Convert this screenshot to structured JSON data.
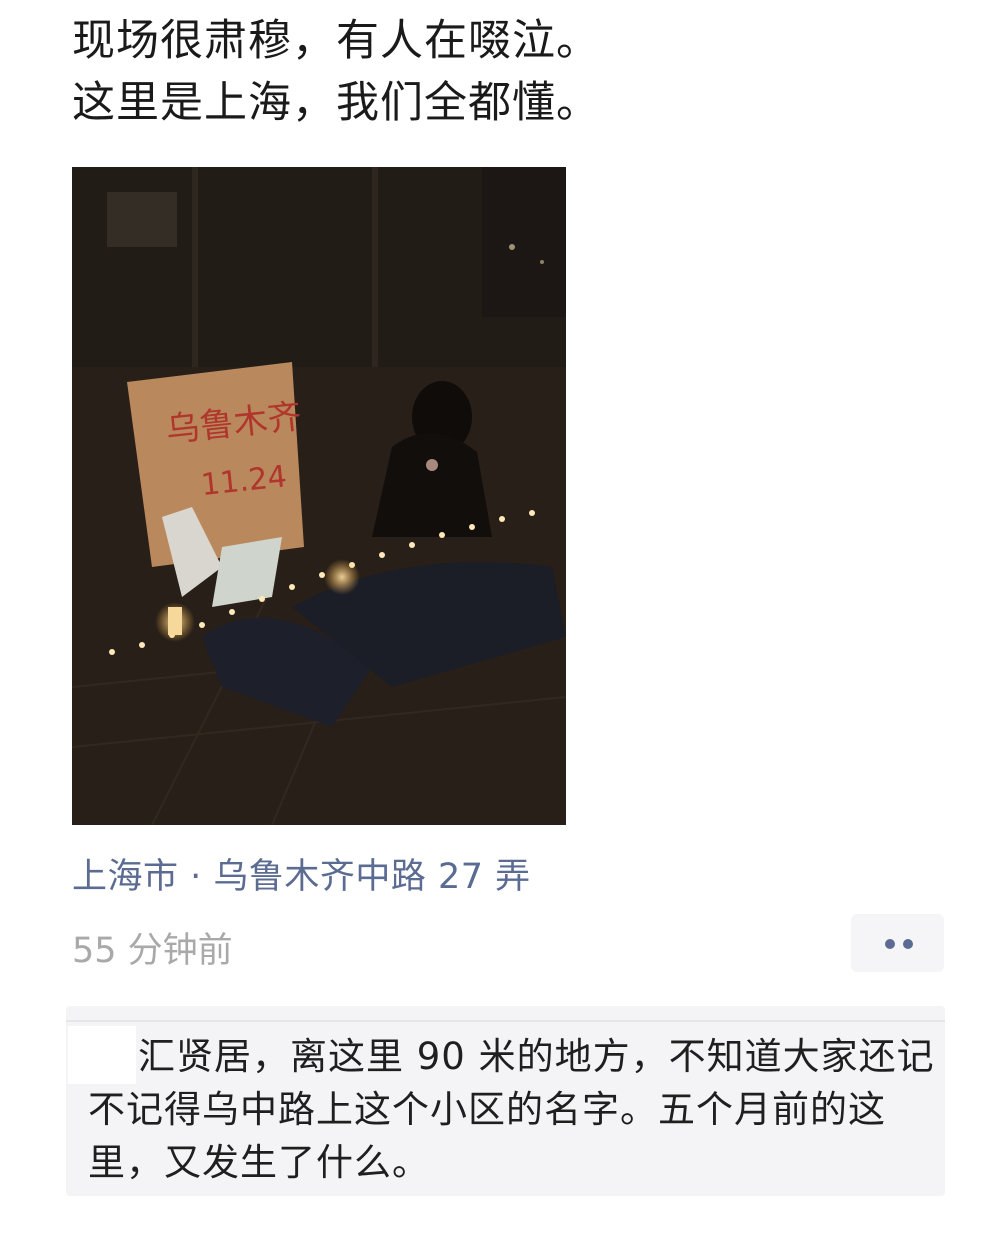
{
  "post": {
    "text_lines": [
      "现场很肃穆，有人在啜泣。",
      "这里是上海，我们全都懂。"
    ],
    "photo": {
      "sign_text_line1": "乌鲁木齐",
      "sign_text_line2": "11.24"
    },
    "location": "上海市 · 乌鲁木齐中路 27 弄",
    "timestamp": "55 分钟前",
    "more_icon": "more-dots-icon"
  },
  "comment": {
    "text": "汇贤居，离这里 90 米的地方，不知道大家还记不记得乌中路上这个小区的名字。五个月前的这里，又发生了什么。"
  },
  "colors": {
    "link_blue": "#5b6b92",
    "timestamp_gray": "#a9a9a9",
    "comment_bg": "#f4f4f6"
  }
}
